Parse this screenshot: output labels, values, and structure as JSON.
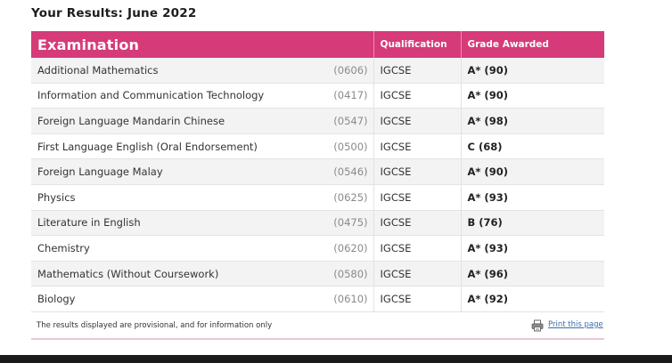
{
  "page": {
    "title": "Your Results: June 2022"
  },
  "table": {
    "header": {
      "examination": "Examination",
      "qualification": "Qualification",
      "grade": "Grade Awarded"
    },
    "rows": [
      {
        "subject": "Additional Mathematics",
        "code": "(0606)",
        "qualification": "IGCSE",
        "grade": "A* (90)"
      },
      {
        "subject": "Information and Communication Technology",
        "code": "(0417)",
        "qualification": "IGCSE",
        "grade": "A* (90)"
      },
      {
        "subject": "Foreign Language Mandarin Chinese",
        "code": "(0547)",
        "qualification": "IGCSE",
        "grade": "A* (98)"
      },
      {
        "subject": "First Language English (Oral Endorsement)",
        "code": "(0500)",
        "qualification": "IGCSE",
        "grade": "C (68)"
      },
      {
        "subject": "Foreign Language Malay",
        "code": "(0546)",
        "qualification": "IGCSE",
        "grade": "A* (90)"
      },
      {
        "subject": "Physics",
        "code": "(0625)",
        "qualification": "IGCSE",
        "grade": "A* (93)"
      },
      {
        "subject": "Literature in English",
        "code": "(0475)",
        "qualification": "IGCSE",
        "grade": "B (76)"
      },
      {
        "subject": "Chemistry",
        "code": "(0620)",
        "qualification": "IGCSE",
        "grade": "A* (93)"
      },
      {
        "subject": "Mathematics (Without Coursework)",
        "code": "(0580)",
        "qualification": "IGCSE",
        "grade": "A* (96)"
      },
      {
        "subject": "Biology",
        "code": "(0610)",
        "qualification": "IGCSE",
        "grade": "A* (92)"
      }
    ]
  },
  "footer": {
    "note": "The results displayed are provisional, and for information only",
    "print_label": "Print this page",
    "print_icon": "printer-icon"
  },
  "colors": {
    "header_accent": "#d63a78",
    "link": "#3a6ea5"
  }
}
